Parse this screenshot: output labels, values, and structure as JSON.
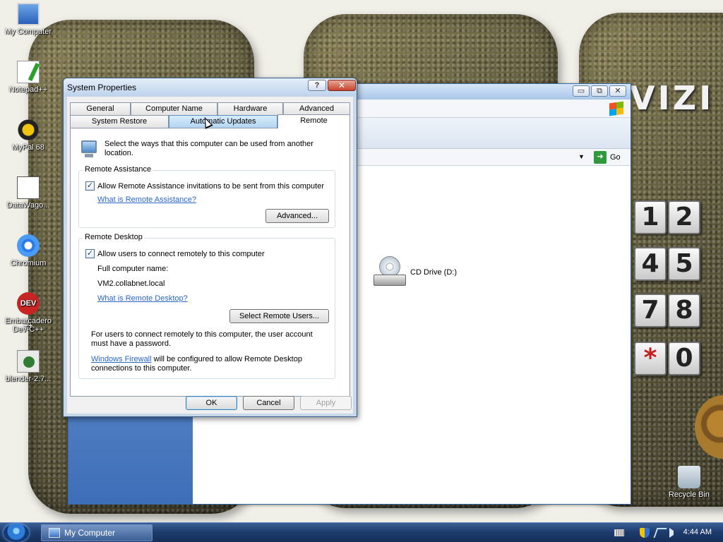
{
  "desktop": {
    "brand_text": "VIZI",
    "keypad": {
      "keys": [
        "1",
        "2",
        "4",
        "5",
        "7",
        "8",
        "*",
        "0"
      ]
    },
    "icons": [
      {
        "label": "My Computer",
        "icon": "computer-icon"
      },
      {
        "label": "Notepad++",
        "icon": "notepad-icon"
      },
      {
        "label": "MyPal 68",
        "icon": "mypal-icon"
      },
      {
        "label": "DataWago...",
        "icon": "datawago-icon"
      },
      {
        "label": "Chromium",
        "icon": "chromium-icon"
      },
      {
        "label": "Embarcadero Dev-C++",
        "icon": "devcpp-icon",
        "glyph": "DEV ++"
      },
      {
        "label": "blender-2.7...",
        "icon": "blender-icon"
      },
      {
        "label": "Recycle Bin",
        "icon": "recycle-bin-icon"
      }
    ]
  },
  "background_window": {
    "title": "My Computer",
    "controls": {
      "minimize": "▭",
      "maximize": "⧉",
      "close": "✕"
    },
    "go_label": "Go",
    "go_arrow": "➔",
    "address_dropdown": "▼",
    "items": [
      {
        "label": "CD Drive (D:)",
        "icon": "cd-drive-icon"
      }
    ]
  },
  "dialog": {
    "title": "System Properties",
    "help_glyph": "?",
    "close_glyph": "✕",
    "tabs_row1": [
      "General",
      "Computer Name",
      "Hardware",
      "Advanced"
    ],
    "tabs_row2": [
      "System Restore",
      "Automatic Updates",
      "Remote"
    ],
    "active_tab": "Remote",
    "intro": "Select the ways that this computer can be used from another location.",
    "remote_assistance": {
      "title": "Remote Assistance",
      "checkbox_label": "Allow Remote Assistance invitations to be sent from this computer",
      "checked": true,
      "link": "What is Remote Assistance?",
      "advanced_button": "Advanced..."
    },
    "remote_desktop": {
      "title": "Remote Desktop",
      "checkbox_label": "Allow users to connect remotely to this computer",
      "checked": true,
      "full_name_label": "Full computer name:",
      "full_name_value": "VM2.collabnet.local",
      "link": "What is Remote Desktop?",
      "select_users_button": "Select Remote Users...",
      "password_note": "For users to connect remotely to this computer, the user account must have a password.",
      "firewall_link": "Windows Firewall",
      "firewall_note": " will be configured to allow Remote Desktop connections to this computer."
    },
    "buttons": {
      "ok": "OK",
      "cancel": "Cancel",
      "apply": "Apply"
    },
    "check_glyph": "✓"
  },
  "taskbar": {
    "task_label": "My Computer",
    "clock": "4:44 AM",
    "tray_icons": [
      "keyboard-icon",
      "security-shield-icon",
      "network-icon",
      "volume-icon"
    ]
  }
}
